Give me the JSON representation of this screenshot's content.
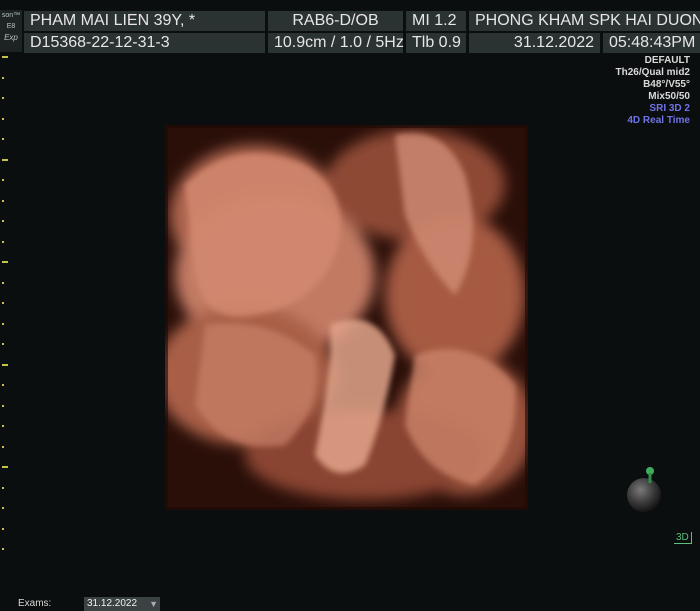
{
  "logo": {
    "line1": "son™",
    "line2": "E8",
    "line3": "Exp"
  },
  "header": {
    "patient": "PHAM MAI LIEN 39Y,  *",
    "probe": "RAB6-D/OB",
    "mi": "MI  1.2",
    "clinic": "PHONG KHAM SPK HAI DUONG",
    "exam_id": "D15368-22-12-31-3",
    "depth": "10.9cm / 1.0 /  5Hz",
    "tib": "Tlb  0.9",
    "date": "31.12.2022",
    "time": "05:48:43PM"
  },
  "params": {
    "p1": "DEFAULT",
    "p2": "Th26/Qual mid2",
    "p3": "B48°/V55°",
    "p4": "Mix50/50",
    "p5": "SRI 3D 2",
    "p6": "4D Real Time"
  },
  "view_label": "3D",
  "footer": {
    "exams_label": "Exams:",
    "exams_value": "31.12.2022"
  },
  "colors": {
    "header_bg": "#2b3232",
    "blue_text": "#6f73e6",
    "tick": "#c8c24a",
    "tissue": "#c98068"
  },
  "icons": {
    "orientation": "orientation-sphere-icon",
    "dropdown": "chevron-down-icon"
  }
}
